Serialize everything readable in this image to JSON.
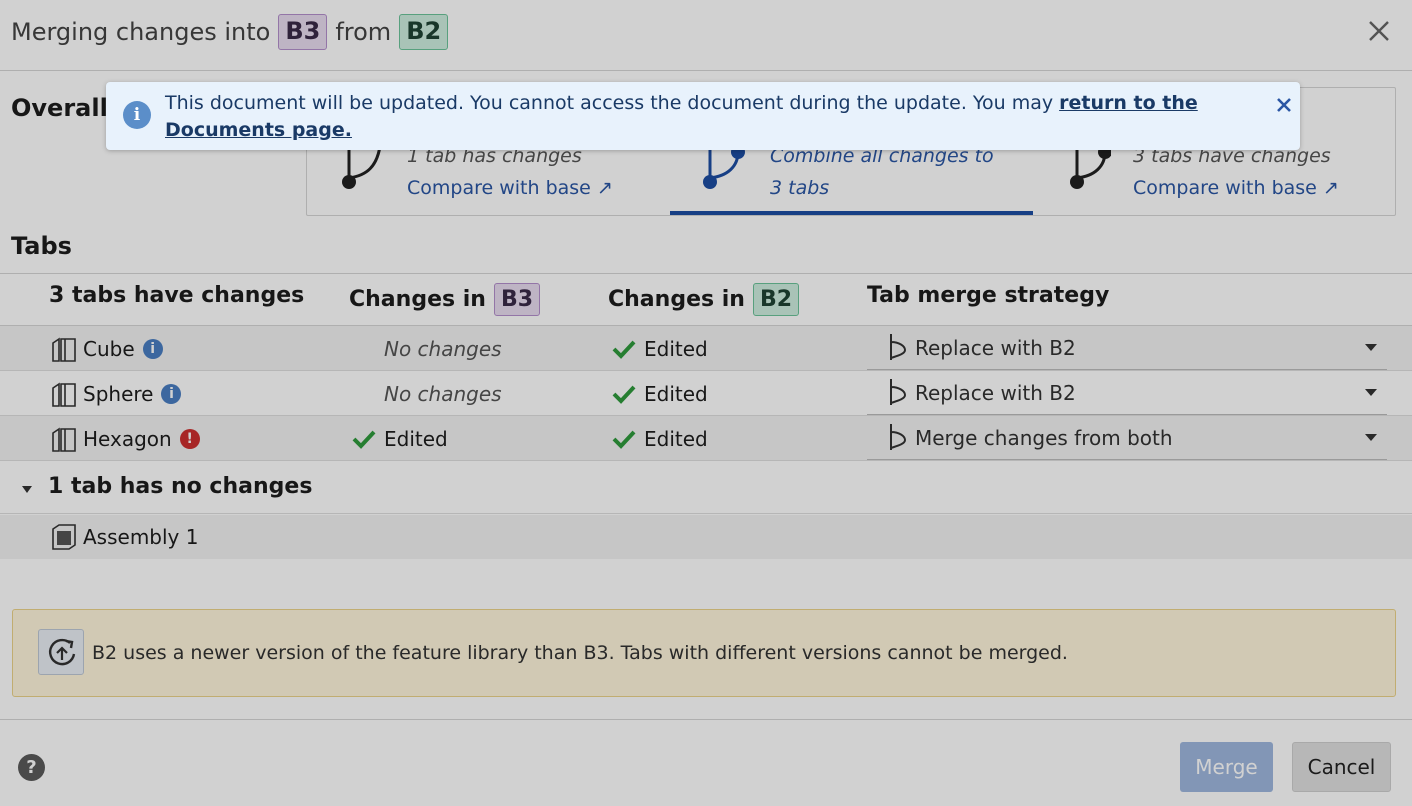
{
  "dialog": {
    "title_prefix": "Merging changes into",
    "target_branch": "B3",
    "title_middle": "from",
    "source_branch": "B2"
  },
  "overall": {
    "label": "Overall",
    "options": [
      {
        "text": "1 tab has changes",
        "link": "Compare with base ↗"
      },
      {
        "text": "Combine all changes to 3 tabs",
        "selected": true
      },
      {
        "text": "3 tabs have changes",
        "link": "Compare with base ↗"
      }
    ]
  },
  "tabs_section": {
    "title": "Tabs",
    "headers": {
      "changed_count": "3 tabs have changes",
      "changes_in": "Changes in",
      "b3": "B3",
      "b2": "B2",
      "strategy": "Tab merge strategy"
    },
    "rows": [
      {
        "name": "Cube",
        "status_icon": "info-icon",
        "b3": "No changes",
        "b2": "Edited",
        "strategy": "Replace with B2"
      },
      {
        "name": "Sphere",
        "status_icon": "info-icon",
        "b3": "No changes",
        "b2": "Edited",
        "strategy": "Replace with B2"
      },
      {
        "name": "Hexagon",
        "status_icon": "error-icon",
        "b3": "Edited",
        "b2": "Edited",
        "strategy": "Merge changes from both"
      }
    ],
    "unchanged_group": "1 tab has no changes",
    "unchanged_rows": [
      {
        "name": "Assembly 1"
      }
    ]
  },
  "warning": {
    "text": "B2 uses a newer version of the feature library than B3. Tabs with different versions cannot be merged."
  },
  "footer": {
    "help": "?",
    "merge_label": "Merge",
    "cancel_label": "Cancel"
  },
  "banner": {
    "text": "This document will be updated. You cannot access the document during the update. You may ",
    "link": "return to the Documents page."
  },
  "colors": {
    "accent": "#1d4da3",
    "link": "#2a56a4",
    "success": "#2f9a3c",
    "error": "#cc2f2f",
    "chip_b3": "#e8dcf0",
    "chip_b2": "#cfeee0",
    "warning_bg": "#fff6dc",
    "banner_bg": "#e8f2fc"
  }
}
